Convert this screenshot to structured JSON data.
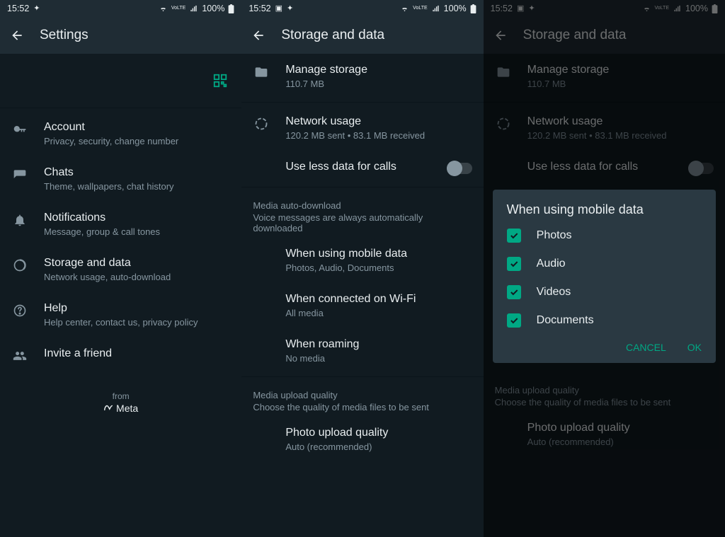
{
  "status": {
    "time": "15:52",
    "time2": "15:52",
    "time3": "15:52",
    "battery": "100%",
    "volte": "VoLTE"
  },
  "pane1": {
    "title": "Settings",
    "items": [
      {
        "title": "Account",
        "sub": "Privacy, security, change number"
      },
      {
        "title": "Chats",
        "sub": "Theme, wallpapers, chat history"
      },
      {
        "title": "Notifications",
        "sub": "Message, group & call tones"
      },
      {
        "title": "Storage and data",
        "sub": "Network usage, auto-download"
      },
      {
        "title": "Help",
        "sub": "Help center, contact us, privacy policy"
      },
      {
        "title": "Invite a friend",
        "sub": ""
      }
    ],
    "from": "from",
    "meta": "Meta"
  },
  "pane2": {
    "title": "Storage and data",
    "manage": {
      "title": "Manage storage",
      "sub": "110.7 MB"
    },
    "network": {
      "title": "Network usage",
      "sub": "120.2 MB sent • 83.1 MB received"
    },
    "less_data": "Use less data for calls",
    "mad_header": "Media auto-download",
    "mad_sub": "Voice messages are always automatically downloaded",
    "mobile": {
      "title": "When using mobile data",
      "sub": "Photos, Audio, Documents"
    },
    "wifi": {
      "title": "When connected on Wi-Fi",
      "sub": "All media"
    },
    "roaming": {
      "title": "When roaming",
      "sub": "No media"
    },
    "muq_header": "Media upload quality",
    "muq_sub": "Choose the quality of media files to be sent",
    "photoq": {
      "title": "Photo upload quality",
      "sub": "Auto (recommended)"
    }
  },
  "dialog": {
    "title": "When using mobile data",
    "options": [
      "Photos",
      "Audio",
      "Videos",
      "Documents"
    ],
    "cancel": "CANCEL",
    "ok": "OK"
  }
}
